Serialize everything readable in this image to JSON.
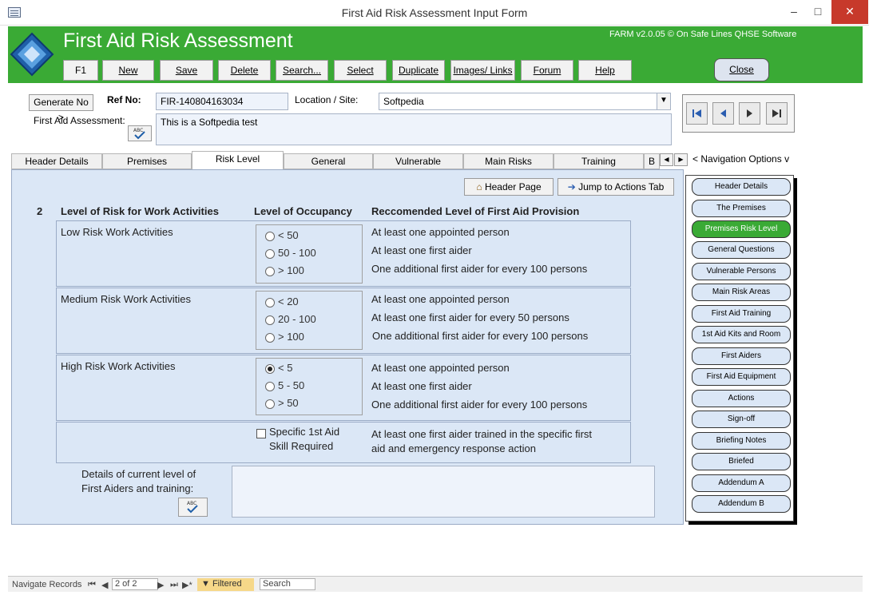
{
  "window": {
    "title": "First Aid Risk Assessment Input Form",
    "minimize": "–",
    "maximize": "□",
    "close": "✕"
  },
  "header": {
    "app_title": "First Aid Risk Assessment",
    "version": "FARM v2.0.05 © On Safe Lines QHSE Software",
    "toolbar": [
      "F1",
      "New",
      "Save",
      "Delete",
      "Search...",
      "Select",
      "Duplicate",
      "Images/ Links",
      "Forum",
      "Help"
    ],
    "close_label": "Close"
  },
  "record": {
    "generate_no_label": "Generate No >",
    "ref_label": "Ref No:",
    "ref_value": "FIR-140804163034",
    "location_label": "Location / Site:",
    "location_value": "Softpedia",
    "assessment_label": "First Aid Assessment:",
    "assessment_value": "This is a Softpedia test"
  },
  "nav_buttons": [
    "first-record",
    "previous-record",
    "next-record",
    "last-record"
  ],
  "tabs": [
    "Header Details",
    "Premises",
    "Risk Level",
    "General",
    "Vulnerable",
    "Main Risks",
    "Training",
    "B"
  ],
  "active_tab": "Risk Level",
  "nav_options_label": "< Navigation Options v",
  "risk_panel": {
    "header_page_label": "Header Page",
    "jump_label": "Jump to Actions Tab",
    "number": "2",
    "col1": "Level of Risk for Work Activities",
    "col2": "Level of Occupancy",
    "col3": "Reccomended Level of First Aid Provision",
    "rows": [
      {
        "risk": "Low Risk Work Activities",
        "options": [
          "< 50",
          "50 - 100",
          "> 100"
        ],
        "provision": [
          "At least one appointed person",
          "At least one first aider",
          "One additional first aider for every 100 persons"
        ]
      },
      {
        "risk": "Medium Risk Work Activities",
        "options": [
          "< 20",
          "20 - 100",
          "> 100"
        ],
        "provision": [
          "At least one appointed person",
          "At least one first aider for every 50 persons",
          "One additional first aider for every 100 persons"
        ]
      },
      {
        "risk": "High Risk Work Activities",
        "options": [
          "< 5",
          "5 - 50",
          "> 50"
        ],
        "provision": [
          "At least one appointed person",
          "At least one first aider",
          "One additional first aider for every 100 persons"
        ]
      }
    ],
    "selected": "< 5",
    "specific_label_1": "Specific 1st Aid",
    "specific_label_2": "Skill Required",
    "specific_text_1": "At least one first aider trained in the specific first",
    "specific_text_2": "aid and emergency response action",
    "details_label_1": "Details of current level of",
    "details_label_2": "First Aiders  and training:",
    "details_value": ""
  },
  "navigation_options": [
    "Header Details",
    "The Premises",
    "Premises Risk Level",
    "General Questions",
    "Vulnerable Persons",
    "Main Risk Areas",
    "First Aid Training",
    "1st Aid Kits and Room",
    "First Aiders",
    "First Aid Equipment",
    "Actions",
    "Sign-off",
    "Briefing Notes",
    "Briefed",
    "Addendum A",
    "Addendum B"
  ],
  "active_nav": "Premises Risk Level",
  "status": {
    "navigate": "Navigate Records",
    "record_pos": "2 of 2",
    "filtered": "Filtered",
    "search_placeholder": "Search"
  },
  "colors": {
    "accent_green": "#3aaa35",
    "panel_blue": "#dbe7f6"
  }
}
